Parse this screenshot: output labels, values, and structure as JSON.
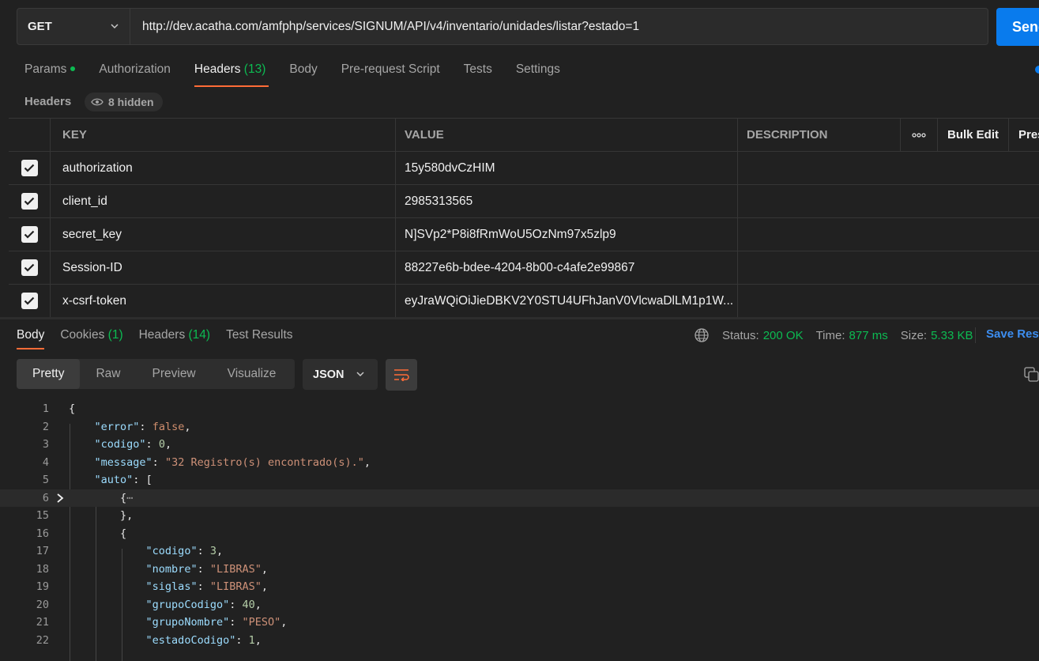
{
  "request": {
    "method": "GET",
    "url": "http://dev.acatha.com/amfphp/services/SIGNUM/API/v4/inventario/unidades/listar?estado=1",
    "send_label": "Send"
  },
  "req_tabs": [
    {
      "label": "Params",
      "active": false
    },
    {
      "label": "Authorization",
      "active": false
    },
    {
      "label": "Headers",
      "count": "(13)",
      "active": true
    },
    {
      "label": "Body",
      "active": false
    },
    {
      "label": "Pre-request Script",
      "active": false
    },
    {
      "label": "Tests",
      "active": false
    },
    {
      "label": "Settings",
      "active": false
    }
  ],
  "headers_section": {
    "title": "Headers",
    "hidden_label": "8 hidden"
  },
  "table": {
    "columns": {
      "key": "KEY",
      "value": "VALUE",
      "description": "DESCRIPTION",
      "bulk_edit": "Bulk Edit",
      "presets": "Presets"
    },
    "rows": [
      {
        "key": "authorization",
        "value": "15y580dvCzHIM"
      },
      {
        "key": "client_id",
        "value": "2985313565"
      },
      {
        "key": "secret_key",
        "value": "N]SVp2*P8i8fRmWoU5OzNm97x5zlp9"
      },
      {
        "key": "Session-ID",
        "value": "88227e6b-bdee-4204-8b00-c4afe2e99867"
      },
      {
        "key": "x-csrf-token",
        "value": "eyJraWQiOiJieDBKV2Y0STU4UFhJanV0VlcwaDlLM1p1W..."
      }
    ]
  },
  "response": {
    "tabs": [
      {
        "label": "Body",
        "active": true
      },
      {
        "label": "Cookies",
        "count": "(1)"
      },
      {
        "label": "Headers",
        "count": "(14)"
      },
      {
        "label": "Test Results"
      }
    ],
    "status_label": "Status:",
    "status_value": "200 OK",
    "time_label": "Time:",
    "time_value": "877 ms",
    "size_label": "Size:",
    "size_value": "5.33 KB",
    "save_label": "Save Response",
    "views": [
      "Pretty",
      "Raw",
      "Preview",
      "Visualize"
    ],
    "format": "JSON"
  },
  "code": {
    "line_numbers": [
      "1",
      "2",
      "3",
      "4",
      "5",
      "6",
      "15",
      "16",
      "17",
      "18",
      "19",
      "20",
      "21",
      "22"
    ],
    "l1": "{",
    "l2k": "\"error\"",
    "l2v": "false",
    "l3k": "\"codigo\"",
    "l3v": "0",
    "l4k": "\"message\"",
    "l4v": "\"32 Registro(s) encontrado(s).\"",
    "l5k": "\"auto\"",
    "l5v": "[",
    "l6": "{",
    "l6e": "⋯",
    "l15": "},",
    "l16": "{",
    "l17k": "\"codigo\"",
    "l17v": "3",
    "l18k": "\"nombre\"",
    "l18v": "\"LIBRAS\"",
    "l19k": "\"siglas\"",
    "l19v": "\"LIBRAS\"",
    "l20k": "\"grupoCodigo\"",
    "l20v": "40",
    "l21k": "\"grupoNombre\"",
    "l21v": "\"PESO\"",
    "l22k": "\"estadoCodigo\"",
    "l22v": "1"
  },
  "colors": {
    "accent": "#ff6c37",
    "send": "#097bed",
    "success": "#0cbb52"
  }
}
